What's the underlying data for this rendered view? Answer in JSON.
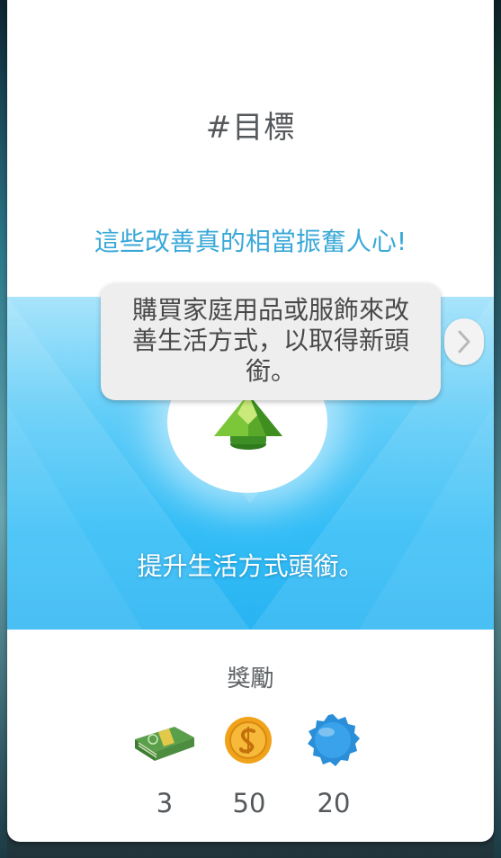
{
  "goal_card": {
    "title": "#目標",
    "subtitle": "這些改善真的相當振奮人心!",
    "tooltip_lines": [
      "購買家庭用品或服飾來改",
      "善生活方式，以取得新頭",
      "銜。"
    ],
    "hero_text": "提升生活方式頭銜。",
    "rewards_title": "獎勵",
    "rewards": [
      {
        "icon": "cash-stack-icon",
        "value": "3"
      },
      {
        "icon": "simoleon-coin-icon",
        "value": "50"
      },
      {
        "icon": "blue-badge-icon",
        "value": "20"
      }
    ]
  },
  "colors": {
    "subtitle": "#3aa8d8",
    "hero_top": "#a9e4fb",
    "hero_bottom": "#29b4f2",
    "plumbob": "#6ab82e"
  }
}
